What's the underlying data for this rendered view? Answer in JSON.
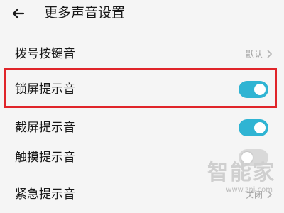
{
  "header": {
    "title": "更多声音设置"
  },
  "rows": [
    {
      "label": "拨号按键音",
      "value": "默认"
    },
    {
      "label": "锁屏提示音",
      "toggle": "on"
    },
    {
      "label": "截屏提示音",
      "toggle": "on"
    },
    {
      "label": "触摸提示音",
      "toggle": "off"
    },
    {
      "label": "紧急提示音",
      "value": "关闭"
    }
  ],
  "watermark": {
    "text": "智能家",
    "url": "www.znj.com"
  },
  "colors": {
    "accent": "#2fb4d3",
    "highlight": "#e0252a",
    "toggle_off": "#d9d9d9",
    "secondary_text": "#a5a5a5"
  },
  "icons": {
    "back": "back-arrow-icon",
    "chevron": "chevron-right-icon"
  }
}
